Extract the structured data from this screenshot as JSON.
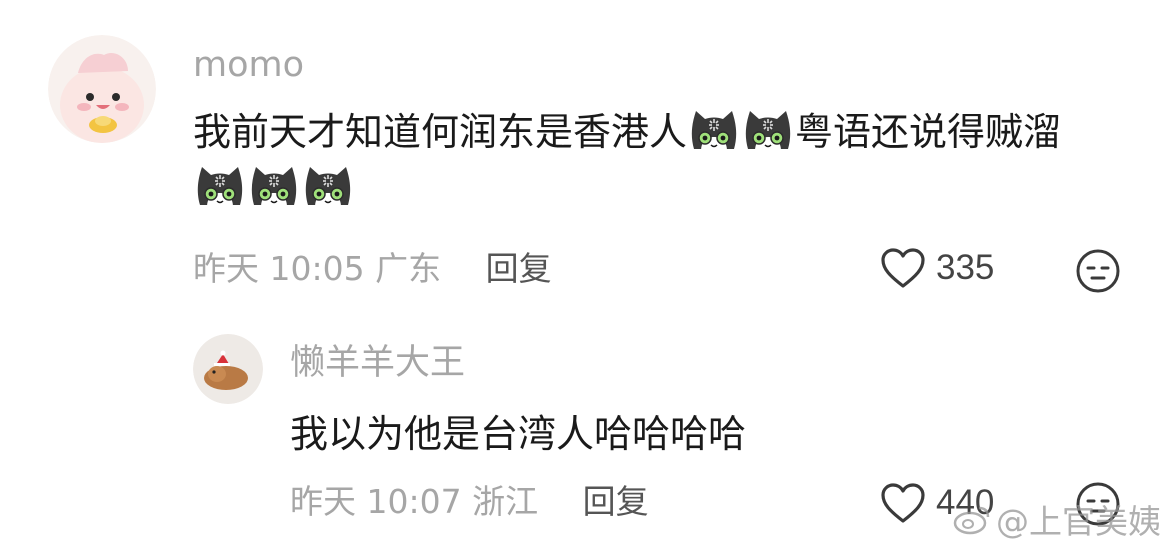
{
  "comments": [
    {
      "username": "momo",
      "text_before": "我前天才知道何润东是香港人",
      "text_middle": "粤语还说得贼溜",
      "time": "昨天 10:05",
      "location": "广东",
      "reply_label": "回复",
      "likes": "335",
      "emoji": "cat-emoji"
    },
    {
      "username": "懒羊羊大王",
      "text": "我以为他是台湾人哈哈哈哈",
      "time": "昨天 10:07",
      "location": "浙江",
      "reply_label": "回复",
      "likes": "440"
    }
  ],
  "watermark": "@上官美姨",
  "colors": {
    "username": "#a6a6a6",
    "text": "#1a1a1a",
    "meta": "#a6a6a6",
    "reply": "#555555"
  }
}
